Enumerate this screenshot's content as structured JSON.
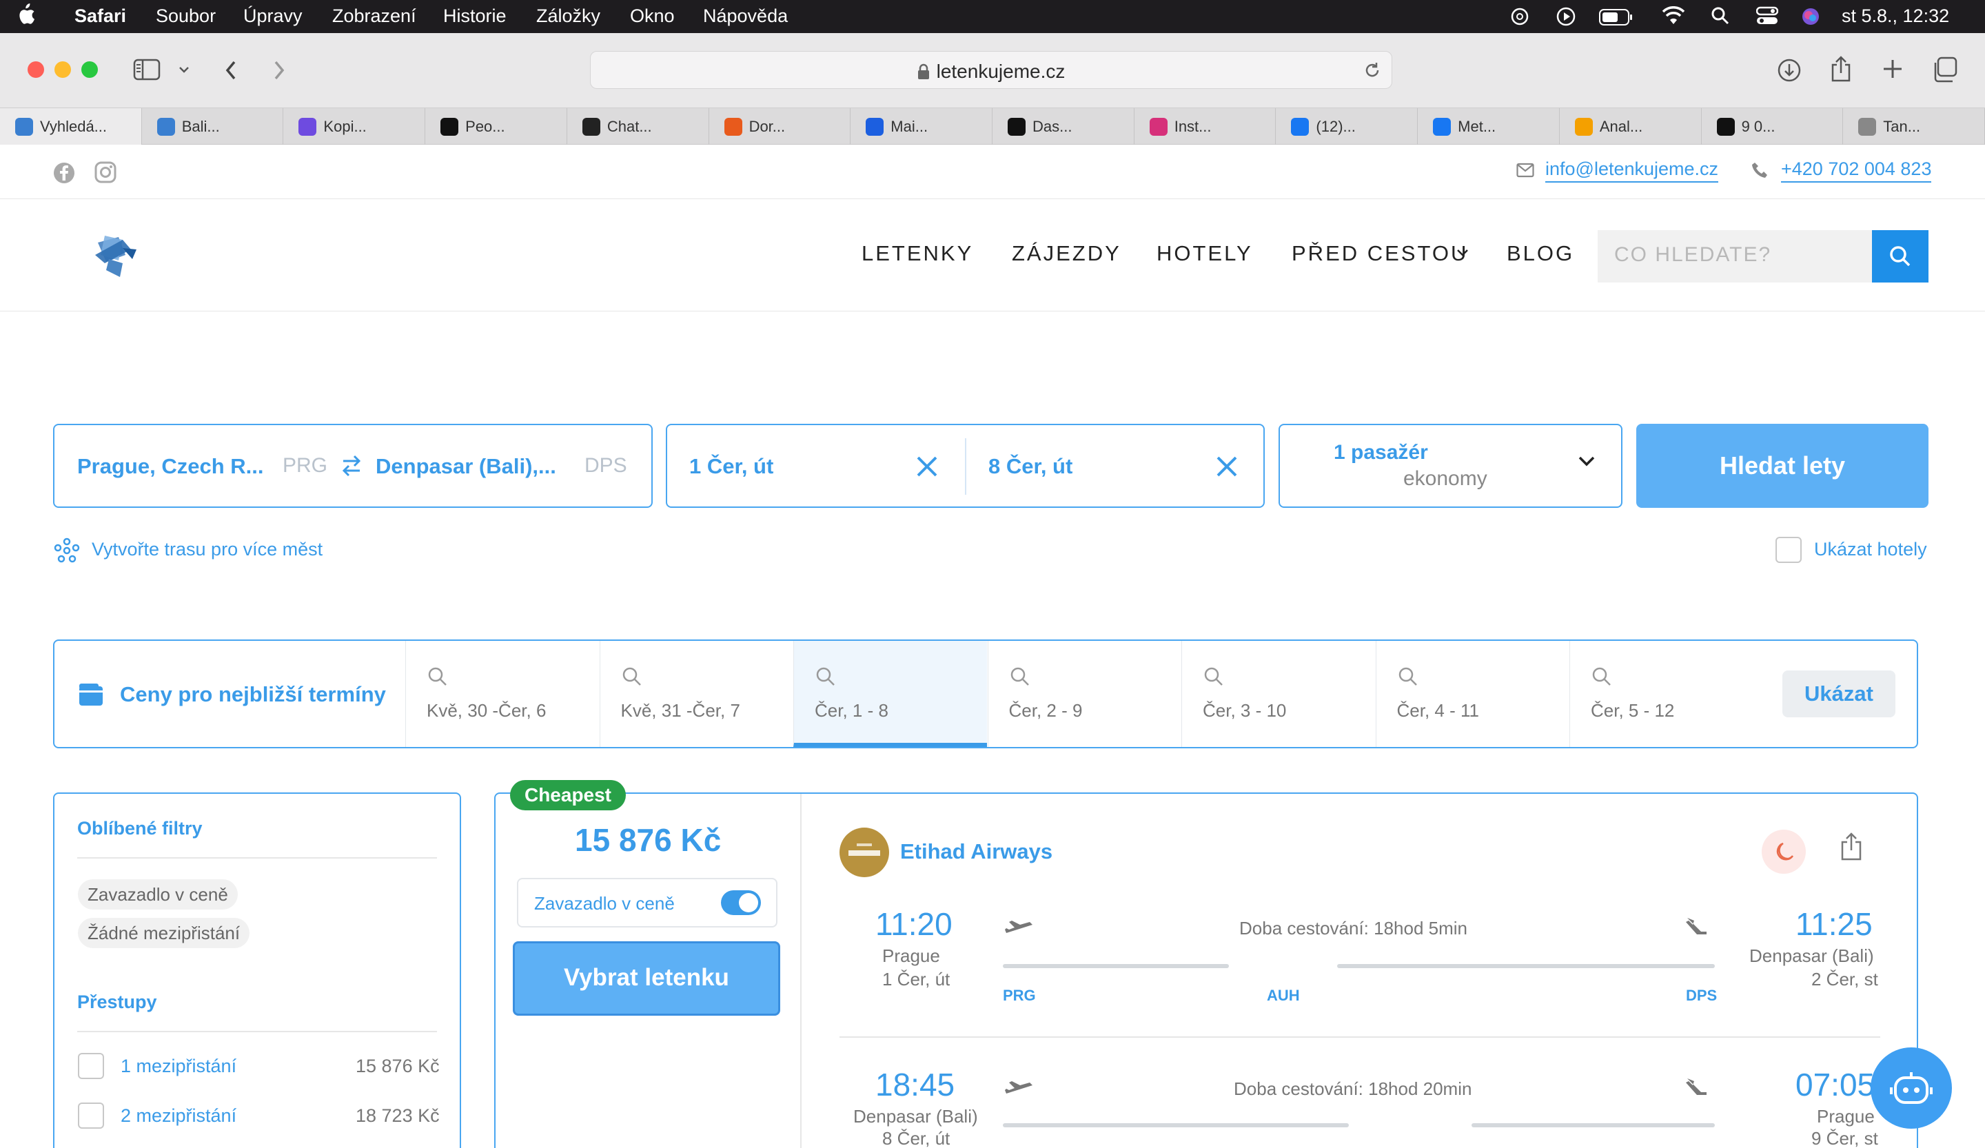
{
  "menubar": {
    "apple": "",
    "items": [
      "Safari",
      "Soubor",
      "Úpravy",
      "Zobrazení",
      "Historie",
      "Záložky",
      "Okno",
      "Nápověda"
    ],
    "clock": "st 5.8.,  12:32"
  },
  "browser": {
    "url": "letenkujeme.cz",
    "tabs": [
      {
        "title": "Vyhledá...",
        "color": "#3a7fd0"
      },
      {
        "title": "Bali...",
        "color": "#3a7fd0"
      },
      {
        "title": "Kopi...",
        "color": "#6e4be0"
      },
      {
        "title": "Peo...",
        "color": "#111111"
      },
      {
        "title": "Chat...",
        "color": "#222222"
      },
      {
        "title": "Dor...",
        "color": "#e85a1c"
      },
      {
        "title": "Mai...",
        "color": "#1c5fe0"
      },
      {
        "title": "Das...",
        "color": "#111111"
      },
      {
        "title": "Inst...",
        "color": "#d6307a"
      },
      {
        "title": "(12)...",
        "color": "#1877f2"
      },
      {
        "title": "Met...",
        "color": "#1877f2"
      },
      {
        "title": "Anal...",
        "color": "#f4a000"
      },
      {
        "title": "9 0...",
        "color": "#111111"
      },
      {
        "title": "Tan...",
        "color": "#888888"
      }
    ]
  },
  "site": {
    "email": "info@letenkujeme.cz",
    "phone": "+420 702 004 823",
    "nav": [
      "LETENKY",
      "ZÁJEZDY",
      "HOTELY",
      "PŘED CESTOU",
      "BLOG"
    ],
    "search_placeholder": "CO HLEDATE?"
  },
  "form": {
    "from": "Prague, Czech R...",
    "from_code": "PRG",
    "to": "Denpasar (Bali),...",
    "to_code": "DPS",
    "date_out": "1 Čer, út",
    "date_back": "8 Čer, út",
    "passengers": "1 pasažér",
    "cabin": "ekonomy",
    "search_button": "Hledat lety",
    "multi_city": "Vytvořte trasu pro více měst",
    "show_hotels": "Ukázat hotely"
  },
  "dates": {
    "title": "Ceny pro nejbližší termíny",
    "options": [
      "Kvě, 30 -Čer, 6",
      "Kvě, 31 -Čer, 7",
      "Čer, 1 - 8",
      "Čer, 2 - 9",
      "Čer, 3 - 10",
      "Čer, 4 - 11",
      "Čer, 5 - 12"
    ],
    "selected_index": 2,
    "show_button": "Ukázat"
  },
  "filters": {
    "favorite_title": "Oblíbené filtry",
    "chips": [
      "Zavazadlo v ceně",
      "Žádné mezipřistání"
    ],
    "transfers_title": "Přestupy",
    "transfers": [
      {
        "label": "1 mezipřistání",
        "price": "15 876 Kč"
      },
      {
        "label": "2 mezipřistání",
        "price": "18 723 Kč"
      }
    ]
  },
  "result": {
    "badge": "Cheapest",
    "price": "15 876 Kč",
    "baggage_label": "Zavazadlo v ceně",
    "baggage_on": true,
    "select_button": "Vybrat letenku",
    "airline": "Etihad Airways",
    "legs": [
      {
        "dep_time": "11:20",
        "dep_city": "Prague",
        "dep_date": "1 Čer, út",
        "duration": "Doba cestování: 18hod 5min",
        "arr_time": "11:25",
        "arr_city": "Denpasar (Bali)",
        "arr_date": "2 Čer, st",
        "codes": [
          "PRG",
          "AUH",
          "DPS"
        ]
      },
      {
        "dep_time": "18:45",
        "dep_city": "Denpasar (Bali)",
        "dep_date": "8 Čer, út",
        "duration": "Doba cestování: 18hod 20min",
        "arr_time": "07:05",
        "arr_city": "Prague",
        "arr_date": "9 Čer, st"
      }
    ]
  },
  "colors": {
    "accent": "#3a9be8",
    "button": "#5db0f5",
    "badge": "#28a048"
  }
}
